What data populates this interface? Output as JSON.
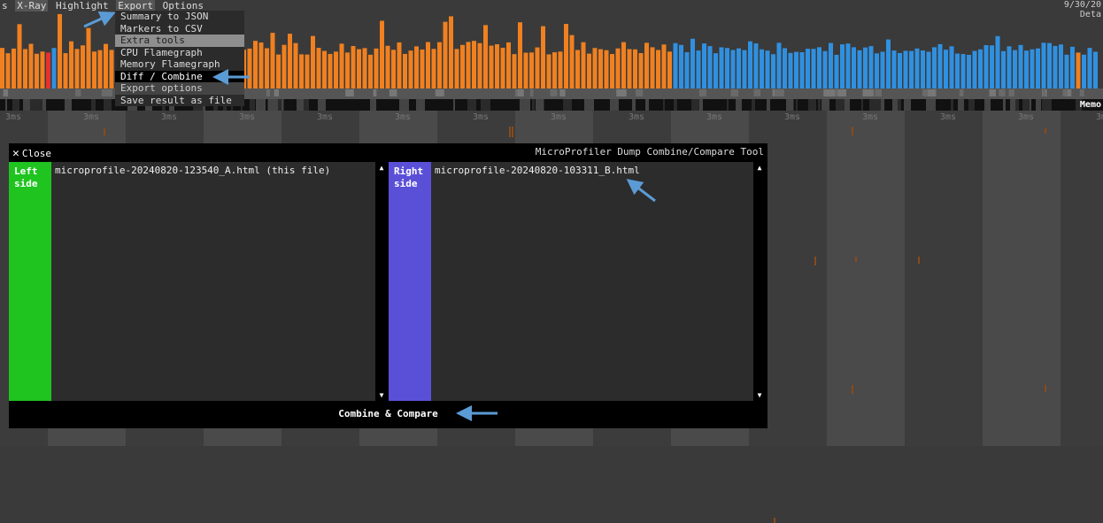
{
  "menubar": {
    "items": [
      {
        "label": "s"
      },
      {
        "label": "X-Ray"
      },
      {
        "label": "Highlight"
      },
      {
        "label": "Export"
      },
      {
        "label": "Options"
      }
    ],
    "date": "9/30/20",
    "detail": "Deta"
  },
  "export_menu": {
    "items": [
      {
        "label": "Summary to JSON"
      },
      {
        "label": "Markers to CSV"
      },
      {
        "label": "Extra tools"
      },
      {
        "label": "CPU Flamegraph"
      },
      {
        "label": "Memory Flamegraph"
      },
      {
        "label": "Diff / Combine"
      },
      {
        "label": "Export options"
      },
      {
        "label": "Save result as file"
      }
    ]
  },
  "timeline": {
    "tick_label": "3ms",
    "memory_label": "Memo"
  },
  "dialog": {
    "close_label": "Close",
    "title": "MicroProfiler Dump Combine/Compare Tool",
    "left": {
      "tag_line1": "Left",
      "tag_line2": "side",
      "file": "microprofile-20240820-123540_A.html (this file)"
    },
    "right": {
      "tag_line1": "Right",
      "tag_line2": "side",
      "file": "microprofile-20240820-103311_B.html"
    },
    "combine_label": "Combine & Compare"
  },
  "colors": {
    "frame_orange": "#f08020",
    "frame_blue": "#3090e0",
    "frame_red": "#e83030",
    "left_side": "#1fc41f",
    "right_side": "#5a50d8",
    "annotation_arrow": "#5b9bd5"
  }
}
